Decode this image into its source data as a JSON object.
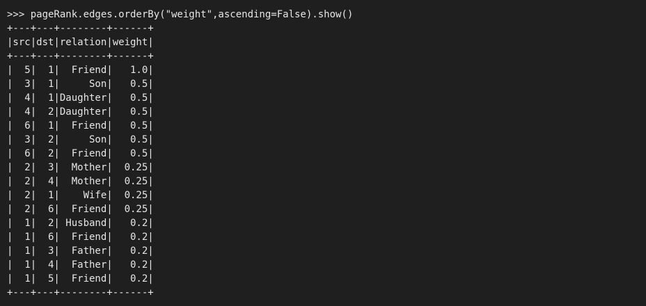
{
  "terminal": {
    "lines": [
      ">>> pageRank.edges.orderBy(\"weight\",ascending=False).show()",
      "+---+---+--------+------+",
      "|src|dst|relation|weight|",
      "+---+---+--------+------+",
      "|  5|  1|  Friend|   1.0|",
      "|  3|  1|     Son|   0.5|",
      "|  4|  1|Daughter|   0.5|",
      "|  4|  2|Daughter|   0.5|",
      "|  6|  1|  Friend|   0.5|",
      "|  3|  2|     Son|   0.5|",
      "|  6|  2|  Friend|   0.5|",
      "|  2|  3|  Mother|  0.25|",
      "|  2|  4|  Mother|  0.25|",
      "|  2|  1|    Wife|  0.25|",
      "|  2|  6|  Friend|  0.25|",
      "|  1|  2| Husband|   0.2|",
      "|  1|  6|  Friend|   0.2|",
      "|  1|  3|  Father|   0.2|",
      "|  1|  4|  Father|   0.2|",
      "|  1|  5|  Friend|   0.2|",
      "+---+---+--------+------+"
    ]
  }
}
